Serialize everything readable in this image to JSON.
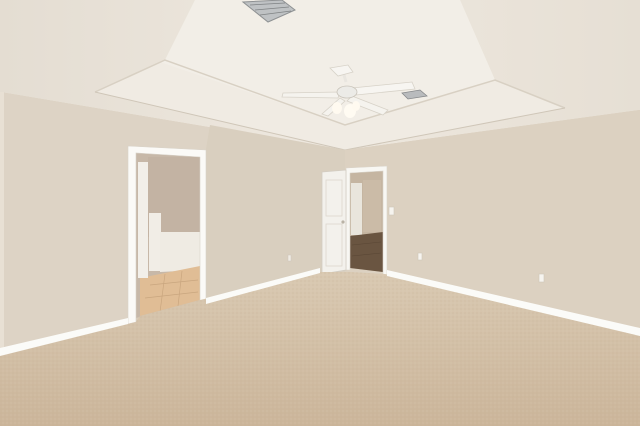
{
  "scene": {
    "description_kind": "photo",
    "elements": [
      "ceiling",
      "tray-ceiling",
      "ceiling-fan",
      "air-vent",
      "left-wall",
      "back-wall",
      "right-wall",
      "bathroom-doorway",
      "hallway-door",
      "carpet-floor",
      "baseboard",
      "outlet",
      "light-switch"
    ]
  },
  "palette": {
    "ceiling": "#ece6dc",
    "tray": "#f1ece4",
    "wall_left": "#ded4c6",
    "wall_back": "#d6cbbb",
    "wall_right": "#ddd2c3",
    "carpet": "#d4c2a8",
    "trim": "#fbfbf8",
    "bath_wall": "#c6b6a6",
    "tile": "#e0bf98",
    "wood": "#6b5742",
    "door": "#f3f1ec"
  }
}
